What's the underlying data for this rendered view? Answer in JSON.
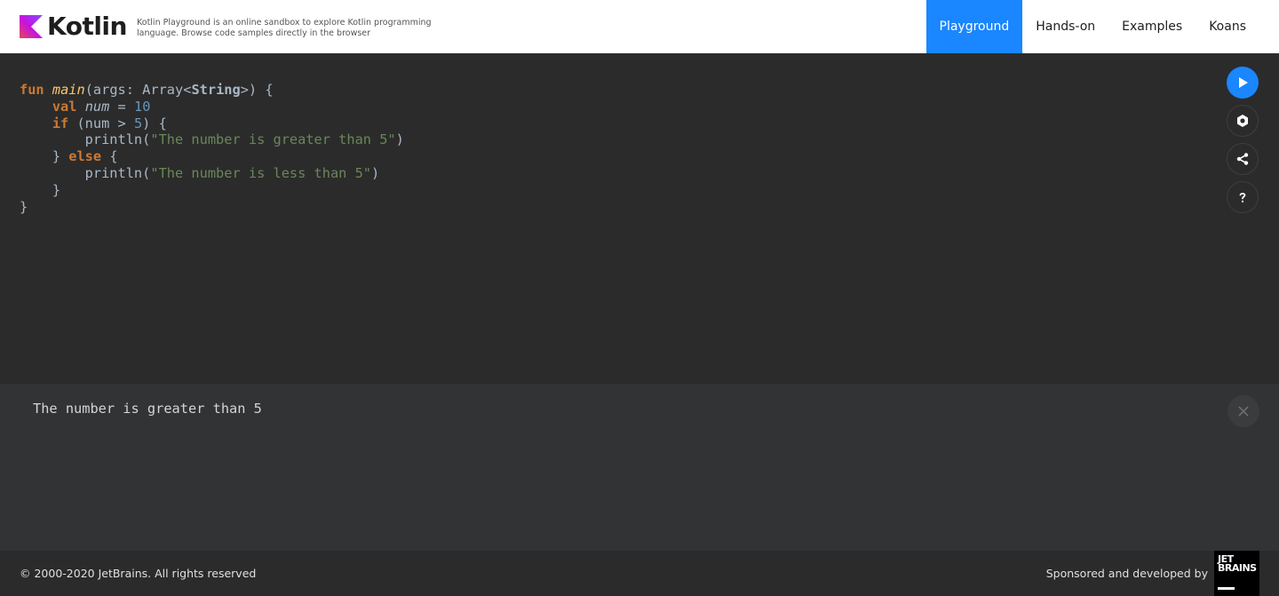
{
  "header": {
    "logo_text": "Kotlin",
    "tagline": "Kotlin Playground is an online sandbox to explore Kotlin programming language. Browse code samples directly in the browser",
    "nav": [
      {
        "label": "Playground",
        "active": true
      },
      {
        "label": "Hands-on",
        "active": false
      },
      {
        "label": "Examples",
        "active": false
      },
      {
        "label": "Koans",
        "active": false
      }
    ]
  },
  "editor": {
    "code_lines": [
      "fun main(args: Array<String>) {",
      "    val num = 10",
      "    if (num > 5) {",
      "        println(\"The number is greater than 5\")",
      "    } else {",
      "        println(\"The number is less than 5\")",
      "    }",
      "}"
    ],
    "buttons": [
      "run-icon",
      "settings-icon",
      "share-icon",
      "help-icon"
    ]
  },
  "output": {
    "text": "The number is greater than 5",
    "close_icon": "close-icon"
  },
  "footer": {
    "copyright": "© 2000-2020 JetBrains. All rights reserved",
    "sponsor": "Sponsored and developed by",
    "jetbrains_logo_text": "JET\nBRAINS"
  },
  "colors": {
    "accent": "#1a86ff",
    "editor_bg": "#2b2b2b",
    "output_bg": "#313335",
    "keyword": "#cc7832",
    "function": "#ffc66d",
    "number": "#6897bb",
    "string": "#6a8759",
    "code_text": "#a9b7c6"
  }
}
